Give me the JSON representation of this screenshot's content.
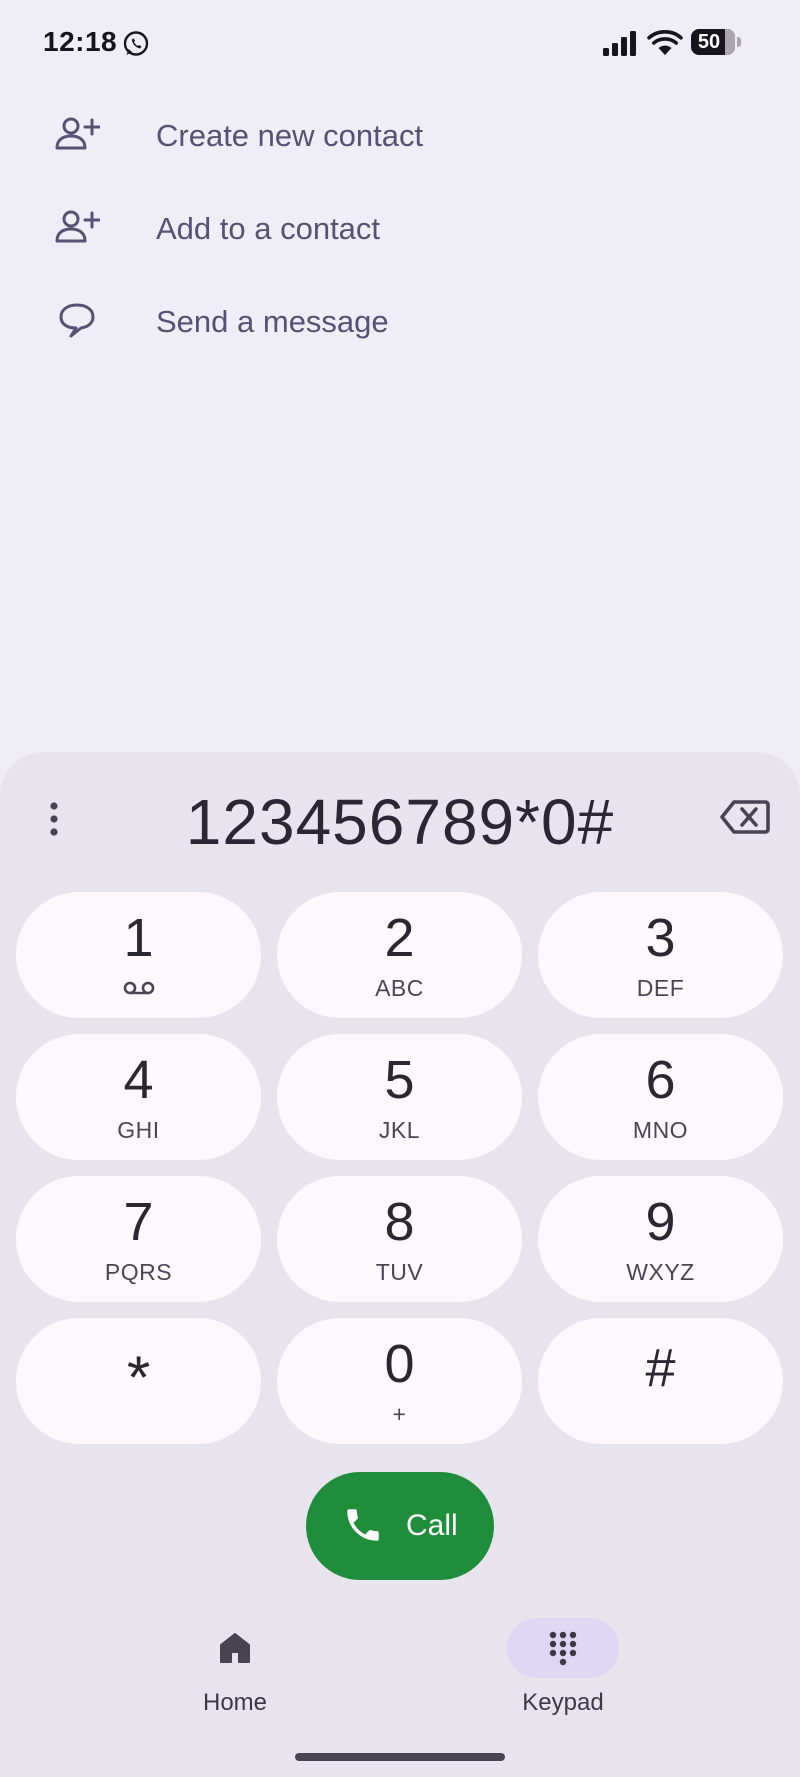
{
  "status_bar": {
    "time": "12:18",
    "notification_icon": "whatsapp-icon",
    "signal_icon": "cellular-signal-icon",
    "wifi_icon": "wifi-icon",
    "battery_level": "50",
    "battery_fraction": 0.5
  },
  "actions": [
    {
      "label": "Create new contact",
      "icon": "add-person-icon"
    },
    {
      "label": "Add to a contact",
      "icon": "add-person-icon"
    },
    {
      "label": "Send a message",
      "icon": "message-bubble-icon"
    }
  ],
  "dialer": {
    "number": "123456789*0#",
    "more_icon": "more-vertical-icon",
    "backspace_icon": "backspace-icon",
    "keys": [
      {
        "digit": "1",
        "letters": "",
        "sub_icon": "voicemail-icon"
      },
      {
        "digit": "2",
        "letters": "ABC"
      },
      {
        "digit": "3",
        "letters": "DEF"
      },
      {
        "digit": "4",
        "letters": "GHI"
      },
      {
        "digit": "5",
        "letters": "JKL"
      },
      {
        "digit": "6",
        "letters": "MNO"
      },
      {
        "digit": "7",
        "letters": "PQRS"
      },
      {
        "digit": "8",
        "letters": "TUV"
      },
      {
        "digit": "9",
        "letters": "WXYZ"
      },
      {
        "digit": "*",
        "letters": ""
      },
      {
        "digit": "0",
        "letters": "+"
      },
      {
        "digit": "#",
        "letters": ""
      }
    ],
    "call_label": "Call",
    "call_icon": "phone-icon"
  },
  "bottom_nav": {
    "items": [
      {
        "label": "Home",
        "icon": "home-icon",
        "active": false
      },
      {
        "label": "Keypad",
        "icon": "dialpad-icon",
        "active": true
      }
    ]
  },
  "colors": {
    "background": "#efedf5",
    "sheet": "#e7e4ee",
    "key": "#fcf8fc",
    "accent_text": "#575274",
    "call_green": "#1f8d3c",
    "nav_active": "#ddd7f4"
  }
}
